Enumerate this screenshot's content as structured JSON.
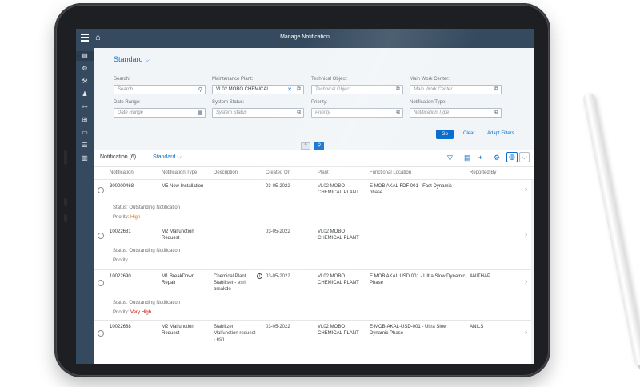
{
  "app": {
    "title": "Manage Notification"
  },
  "filter": {
    "variant": "Standard",
    "fields": [
      {
        "label": "Search:",
        "placeholder": "Search",
        "value": ""
      },
      {
        "label": "Maintenance Plant:",
        "placeholder": "",
        "value": "VL02 MOBO CHEMICAL..."
      },
      {
        "label": "Technical Object:",
        "placeholder": "Technical Object",
        "value": ""
      },
      {
        "label": "Main Work Center:",
        "placeholder": "Main Work Center",
        "value": ""
      },
      {
        "label": "Date Range:",
        "placeholder": "Date Range",
        "value": ""
      },
      {
        "label": "System Status:",
        "placeholder": "System Status",
        "value": ""
      },
      {
        "label": "Priority:",
        "placeholder": "Priority",
        "value": ""
      },
      {
        "label": "Notification Type:",
        "placeholder": "Notification Type",
        "value": ""
      }
    ],
    "go": "Go",
    "clear": "Clear",
    "adapt": "Adapt Filters"
  },
  "table": {
    "count_label": "Notification (6)",
    "variant": "Standard",
    "columns": [
      "Notification",
      "Notification Type",
      "Description",
      "Created On",
      "Plant",
      "Functional Location",
      "Reported By"
    ],
    "rows": [
      {
        "id": "300000468",
        "type": "M5 New Installation",
        "desc": "",
        "created": "03-05-2022",
        "plant": "VL02 MOBO CHEMICAL PLANT",
        "floc": "E MOB AKAL FDF 001 - Fast Dynamic phase",
        "by": "",
        "status_label": "Status:",
        "status": "Outstanding Notification",
        "priority_label": "Priority:",
        "priority": "High"
      },
      {
        "id": "10022681",
        "type": "M2 Malfunction Request",
        "desc": "",
        "created": "03-05-2022",
        "plant": "VL02 MOBO CHEMICAL PLANT",
        "floc": "",
        "by": "",
        "status_label": "Status:",
        "status": "Outstanding Notification",
        "priority_label": "Priority",
        "priority": ""
      },
      {
        "id": "10022690",
        "type": "M1 BreakDown Repair",
        "desc": "Chemical Plant Stabiliser - esri breakdo",
        "created": "03-05-2022",
        "plant": "VL02 MOBO CHEMICAL PLANT",
        "floc": "E MOB AKAL USD 001 - Ultra Slow Dynamic Phase",
        "by": "ANITHAP",
        "status_label": "Status:",
        "status": "Outstanding Notification",
        "priority_label": "Priority:",
        "priority": "Very High"
      },
      {
        "id": "10022688",
        "type": "M2 Malfunction Request",
        "desc": "Stabliizer Malfunction request - esri",
        "created": "03-05-2022",
        "plant": "VL02 MOBO CHEMICAL PLANT",
        "floc": "E-MOB-AKAL-USD-001 - Ultra Slow Dynamic Phase",
        "by": "ANILS",
        "status_label": "",
        "status": "",
        "priority_label": "",
        "priority": ""
      }
    ]
  },
  "icons": {
    "menu": "menu-icon",
    "home": "home-icon",
    "filter": "filter-icon",
    "export": "export-icon",
    "add": "add-icon",
    "settings": "gear-icon"
  }
}
